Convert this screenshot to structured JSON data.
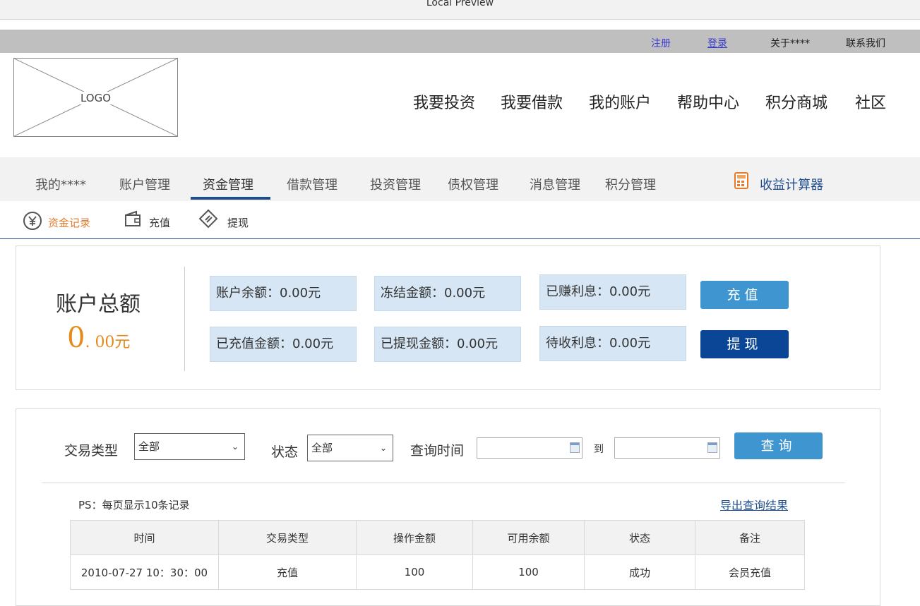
{
  "preview": {
    "title": "Local Preview"
  },
  "top_links": {
    "register": "注册",
    "login": "登录",
    "about": "关于****",
    "contact": "联系我们"
  },
  "logo": {
    "text": "LOGO"
  },
  "main_nav": [
    "我要投资",
    "我要借款",
    "我的账户",
    "帮助中心",
    "积分商城",
    "社区"
  ],
  "sub_nav": {
    "items": [
      "我的****",
      "账户管理",
      "资金管理",
      "借款管理",
      "投资管理",
      "债权管理",
      "消息管理",
      "积分管理"
    ],
    "active": "资金管理",
    "calculator": "收益计算器",
    "calculator_icon": "calculator-icon"
  },
  "actions": [
    {
      "label": "资金记录",
      "icon": "yen-circle-icon",
      "active": true
    },
    {
      "label": "充值",
      "icon": "wallet-icon",
      "active": false
    },
    {
      "label": "提现",
      "icon": "withdraw-tag-icon",
      "active": false
    }
  ],
  "summary": {
    "title": "账户总额",
    "amount_int": "0",
    "amount_dec": ". 00元",
    "stats": [
      "账户余额：0.00元",
      "冻结金额：0.00元",
      "已赚利息：0.00元",
      "已充值金额：0.00元",
      "已提现金额：0.00元",
      "待收利息：0.00元"
    ],
    "recharge_button": "充值",
    "withdraw_button": "提现"
  },
  "filters": {
    "type_label": "交易类型",
    "type_value": "全部",
    "status_label": "状态",
    "status_value": "全部",
    "time_label": "查询时间",
    "to_label": "到",
    "query_button": "查询"
  },
  "records": {
    "note": "PS：每页显示10条记录",
    "export_link": "导出查询结果",
    "columns": [
      "时间",
      "交易类型",
      "操作金额",
      "可用余额",
      "状态",
      "备注"
    ],
    "rows": [
      [
        "2010-07-27 10：30：00",
        "充值",
        "100",
        "100",
        "成功",
        "会员充值"
      ]
    ]
  },
  "colors": {
    "brand_blue": "#1f4d8c",
    "light_blue_button": "#3f95d0",
    "dark_blue_button": "#0b4596",
    "accent_orange": "#e58a1b",
    "stat_box_bg": "#d6e6f4"
  }
}
